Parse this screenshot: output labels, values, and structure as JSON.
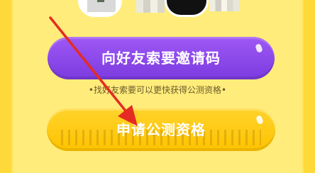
{
  "colors": {
    "page_bg": "#FDE35A",
    "invite_button": "#8E49EE",
    "apply_button": "#FFC80F",
    "arrow": "#E52C22",
    "hint_text": "#6B5A2E"
  },
  "header": {
    "left_avatar_icon": "avatar-icon",
    "right_avatar_icon": "avatar-icon"
  },
  "main": {
    "invite_button_label": "向好友索要邀请码",
    "hint_text": "•找好友索要可以更快获得公测资格•",
    "apply_button_label": "申请公测资格"
  },
  "annotation": {
    "arrow_icon": "red-arrow-icon"
  }
}
